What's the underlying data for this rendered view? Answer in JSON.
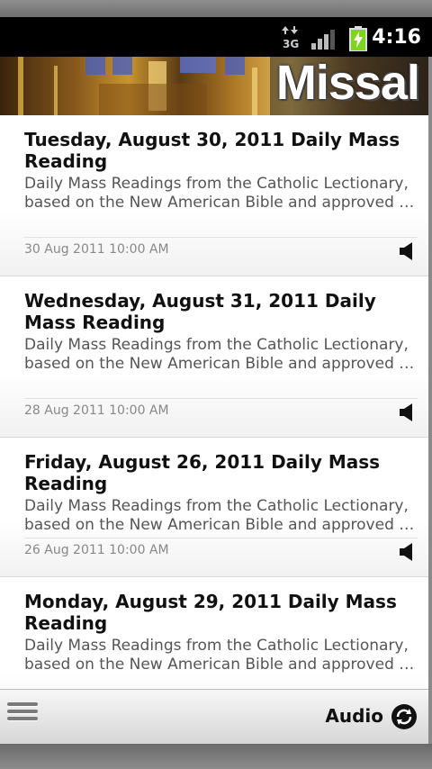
{
  "status_bar": {
    "network_label": "3G",
    "time": "4:16"
  },
  "banner": {
    "title": "Missal"
  },
  "items": [
    {
      "title": "Tuesday, August 30, 2011 Daily Mass Reading",
      "desc_line1": "Daily Mass Readings from the Catholic Lectionary,",
      "desc_line2": "based on the New American Bible and approved fo...",
      "date": "30 Aug 2011 10:00 AM"
    },
    {
      "title": "Wednesday, August 31, 2011 Daily Mass Reading",
      "desc_line1": "Daily Mass Readings from the Catholic Lectionary,",
      "desc_line2": "based on the New American Bible and approved fo...",
      "date": "28 Aug 2011 10:00 AM"
    },
    {
      "title": "Friday, August 26, 2011 Daily Mass Reading",
      "desc_line1": "Daily Mass Readings from the Catholic Lectionary,",
      "desc_line2": "based on the New American Bible and approved fo...",
      "date": "26 Aug 2011 10:00 AM"
    },
    {
      "title": "Monday, August 29, 2011 Daily Mass Reading",
      "desc_line1": "Daily Mass Readings from the Catholic Lectionary,",
      "desc_line2": "based on the New American Bible and approved fo...",
      "date": ""
    }
  ],
  "bottom_bar": {
    "audio_label": "Audio"
  },
  "icons": {
    "network": "3g-data-icon",
    "signal": "signal-strength-icon",
    "battery": "battery-charging-icon",
    "speaker": "speaker-icon",
    "menu": "menu-icon",
    "refresh": "refresh-icon"
  },
  "colors": {
    "status_bar_bg": "#000000",
    "battery_fill": "#7fd321",
    "title_text": "#111111",
    "desc_text": "#555555",
    "meta_text": "#888888"
  }
}
